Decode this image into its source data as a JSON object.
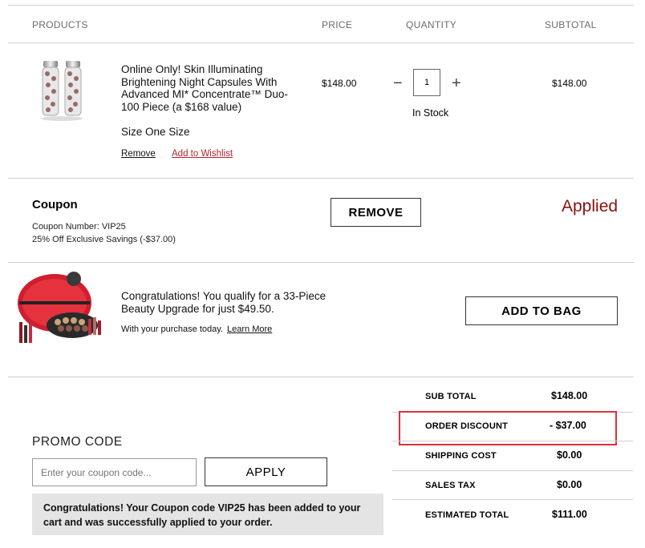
{
  "headers": {
    "products": "PRODUCTS",
    "price": "PRICE",
    "quantity": "QUANTITY",
    "subtotal": "SUBTOTAL"
  },
  "item": {
    "name": "Online Only! Skin Illuminating Brightening Night Capsules With Advanced MI* Concentrate™ Duo-100 Piece (a $168 value)",
    "size": "Size One Size",
    "price": "$148.00",
    "quantity": "1",
    "minus_symbol": "−",
    "plus_symbol": "+",
    "stock": "In Stock",
    "subtotal": "$148.00",
    "remove": "Remove",
    "wishlist": "Add to Wishlist"
  },
  "coupon": {
    "title": "Coupon",
    "number": "Coupon Number: VIP25",
    "description": "25% Off Exclusive Savings (-$37.00)",
    "remove_button": "REMOVE",
    "status": "Applied"
  },
  "upsell": {
    "message": "Congratulations! You qualify for a 33-Piece Beauty Upgrade for just $49.50.",
    "subtext": "With your purchase today.",
    "learn_more": "Learn More",
    "button": "ADD TO BAG"
  },
  "promo": {
    "label": "PROMO CODE",
    "placeholder": "Enter your coupon code...",
    "apply": "APPLY",
    "success": "Congratulations! Your Coupon code VIP25 has been added to your cart and was successfully applied to your order."
  },
  "summary": {
    "rows": [
      {
        "label": "SUB TOTAL",
        "value": "$148.00"
      },
      {
        "label": "ORDER DISCOUNT",
        "value": "- $37.00"
      },
      {
        "label": "SHIPPING COST",
        "value": "$0.00"
      },
      {
        "label": "SALES TAX",
        "value": "$0.00"
      },
      {
        "label": "ESTIMATED TOTAL",
        "value": "$111.00"
      }
    ]
  },
  "colors": {
    "link_red": "#b0262d",
    "applied_red": "#8b1010",
    "highlight_box": "#d9323a",
    "success_bg": "#e4e4e4"
  },
  "icons": {
    "product_image": "night-capsules-duo-image",
    "upgrade_image": "beauty-upgrade-kit-image"
  }
}
